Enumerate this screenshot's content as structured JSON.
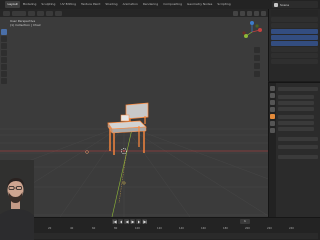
{
  "workspaces": {
    "tabs": [
      "Layout",
      "Modeling",
      "Sculpting",
      "UV Editing",
      "Texture Paint",
      "Shading",
      "Animation",
      "Rendering",
      "Compositing",
      "Geometry Nodes",
      "Scripting"
    ],
    "active_index": 0
  },
  "scene": {
    "label": "Scene"
  },
  "viewport": {
    "info_line1": "User Perspective",
    "info_line2": "(1) Collection | Chair",
    "object": "chair",
    "selection_color": "#ff8a3d",
    "axis_x_color": "#c7413e",
    "axis_y_color": "#8fb837",
    "grid_color": "#4a4a4a",
    "background": "#3b3b3b"
  },
  "timeline": {
    "ticks": [
      "0",
      "20",
      "40",
      "60",
      "80",
      "100",
      "120",
      "140",
      "160",
      "180",
      "200",
      "220",
      "240"
    ],
    "current_frame": "1"
  },
  "icons": {
    "gizmo": "navigation-gizmo-icon",
    "play": "play-icon",
    "jump_start": "jump-start-icon",
    "jump_end": "jump-end-icon"
  }
}
